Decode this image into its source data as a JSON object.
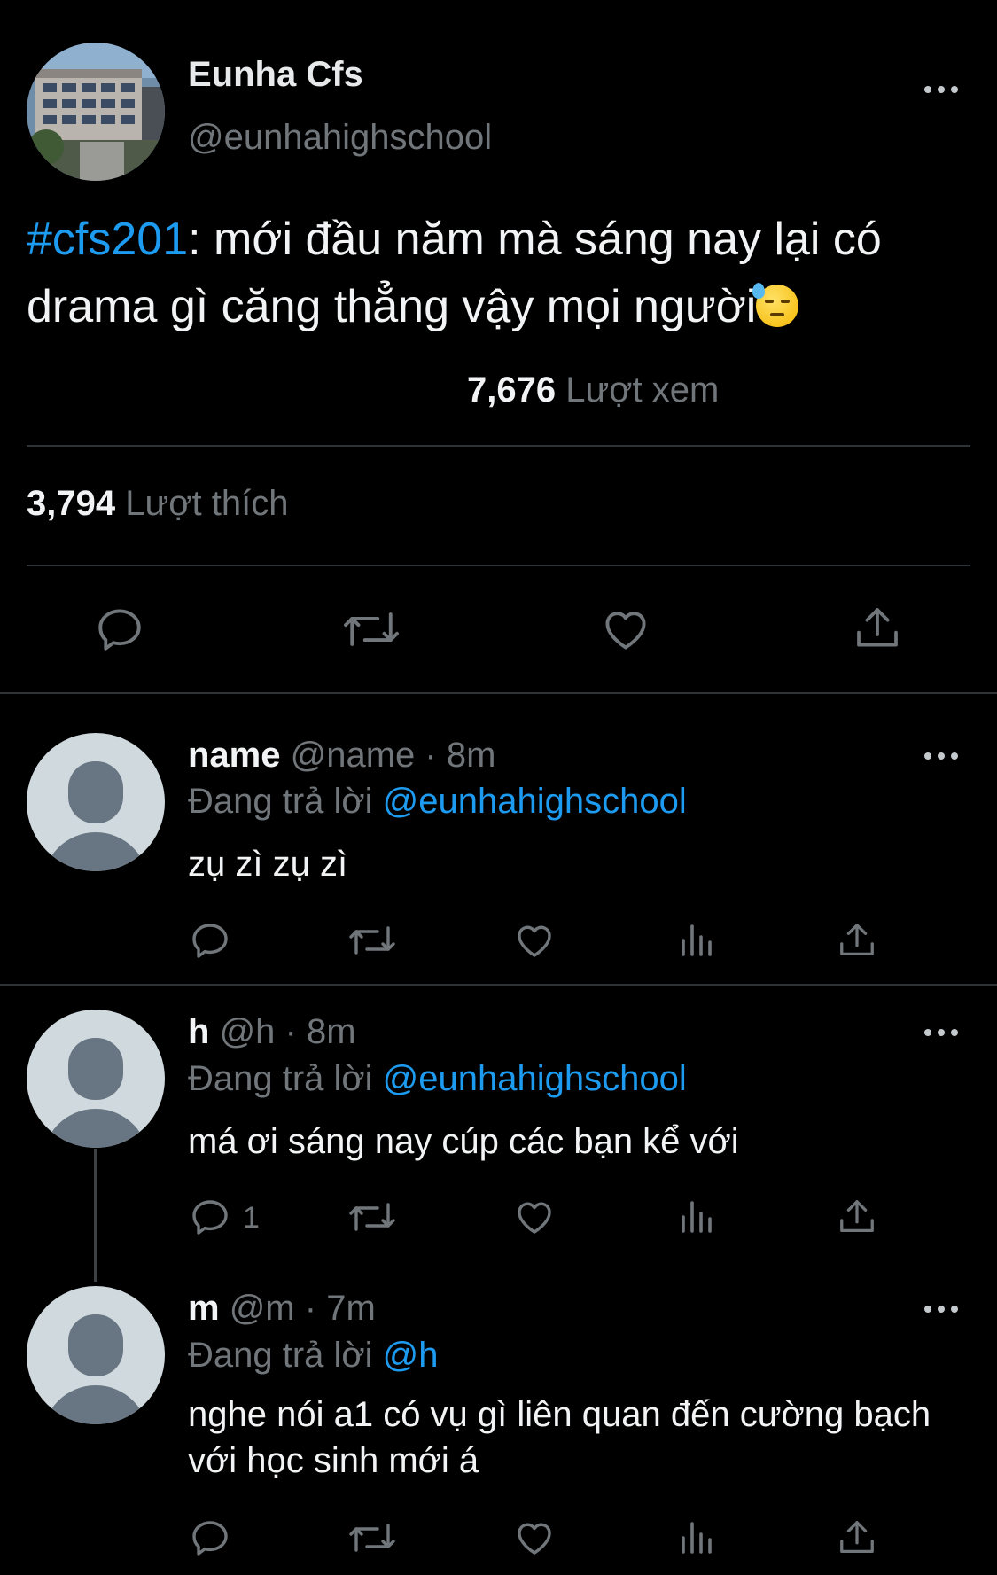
{
  "main_tweet": {
    "display_name": "Eunha Cfs",
    "handle": "@eunhahighschool",
    "hashtag": "#cfs201",
    "text": ": mới đầu năm mà sáng nay lại có drama gì căng thẳng vậy mọi người",
    "emoji_icon": "downcast-face-with-sweat-icon",
    "views_count": "7,676",
    "views_label": "Lượt xem",
    "likes_count": "3,794",
    "likes_label": "Lượt thích"
  },
  "replies": [
    {
      "name": "name",
      "handle": "@name",
      "time": "· 8m",
      "replying_prefix": "Đang trả lời",
      "replying_to": "@eunhahighschool",
      "text": "zụ zì zụ zì",
      "reply_count": ""
    },
    {
      "name": "h",
      "handle": "@h",
      "time": "· 8m",
      "replying_prefix": "Đang trả lời",
      "replying_to": "@eunhahighschool",
      "text": "má ơi sáng nay cúp các bạn kể với",
      "reply_count": "1"
    },
    {
      "name": "m",
      "handle": "@m",
      "time": "· 7m",
      "replying_prefix": "Đang trả lời",
      "replying_to": "@h",
      "text": "nghe nói a1 có vụ gì liên quan đến cường bạch với học sinh mới á",
      "reply_count": ""
    }
  ],
  "colors": {
    "background": "#000000",
    "text": "#e7e9ea",
    "muted": "#71767b",
    "accent": "#1d9bf0",
    "divider": "#2f3336"
  }
}
